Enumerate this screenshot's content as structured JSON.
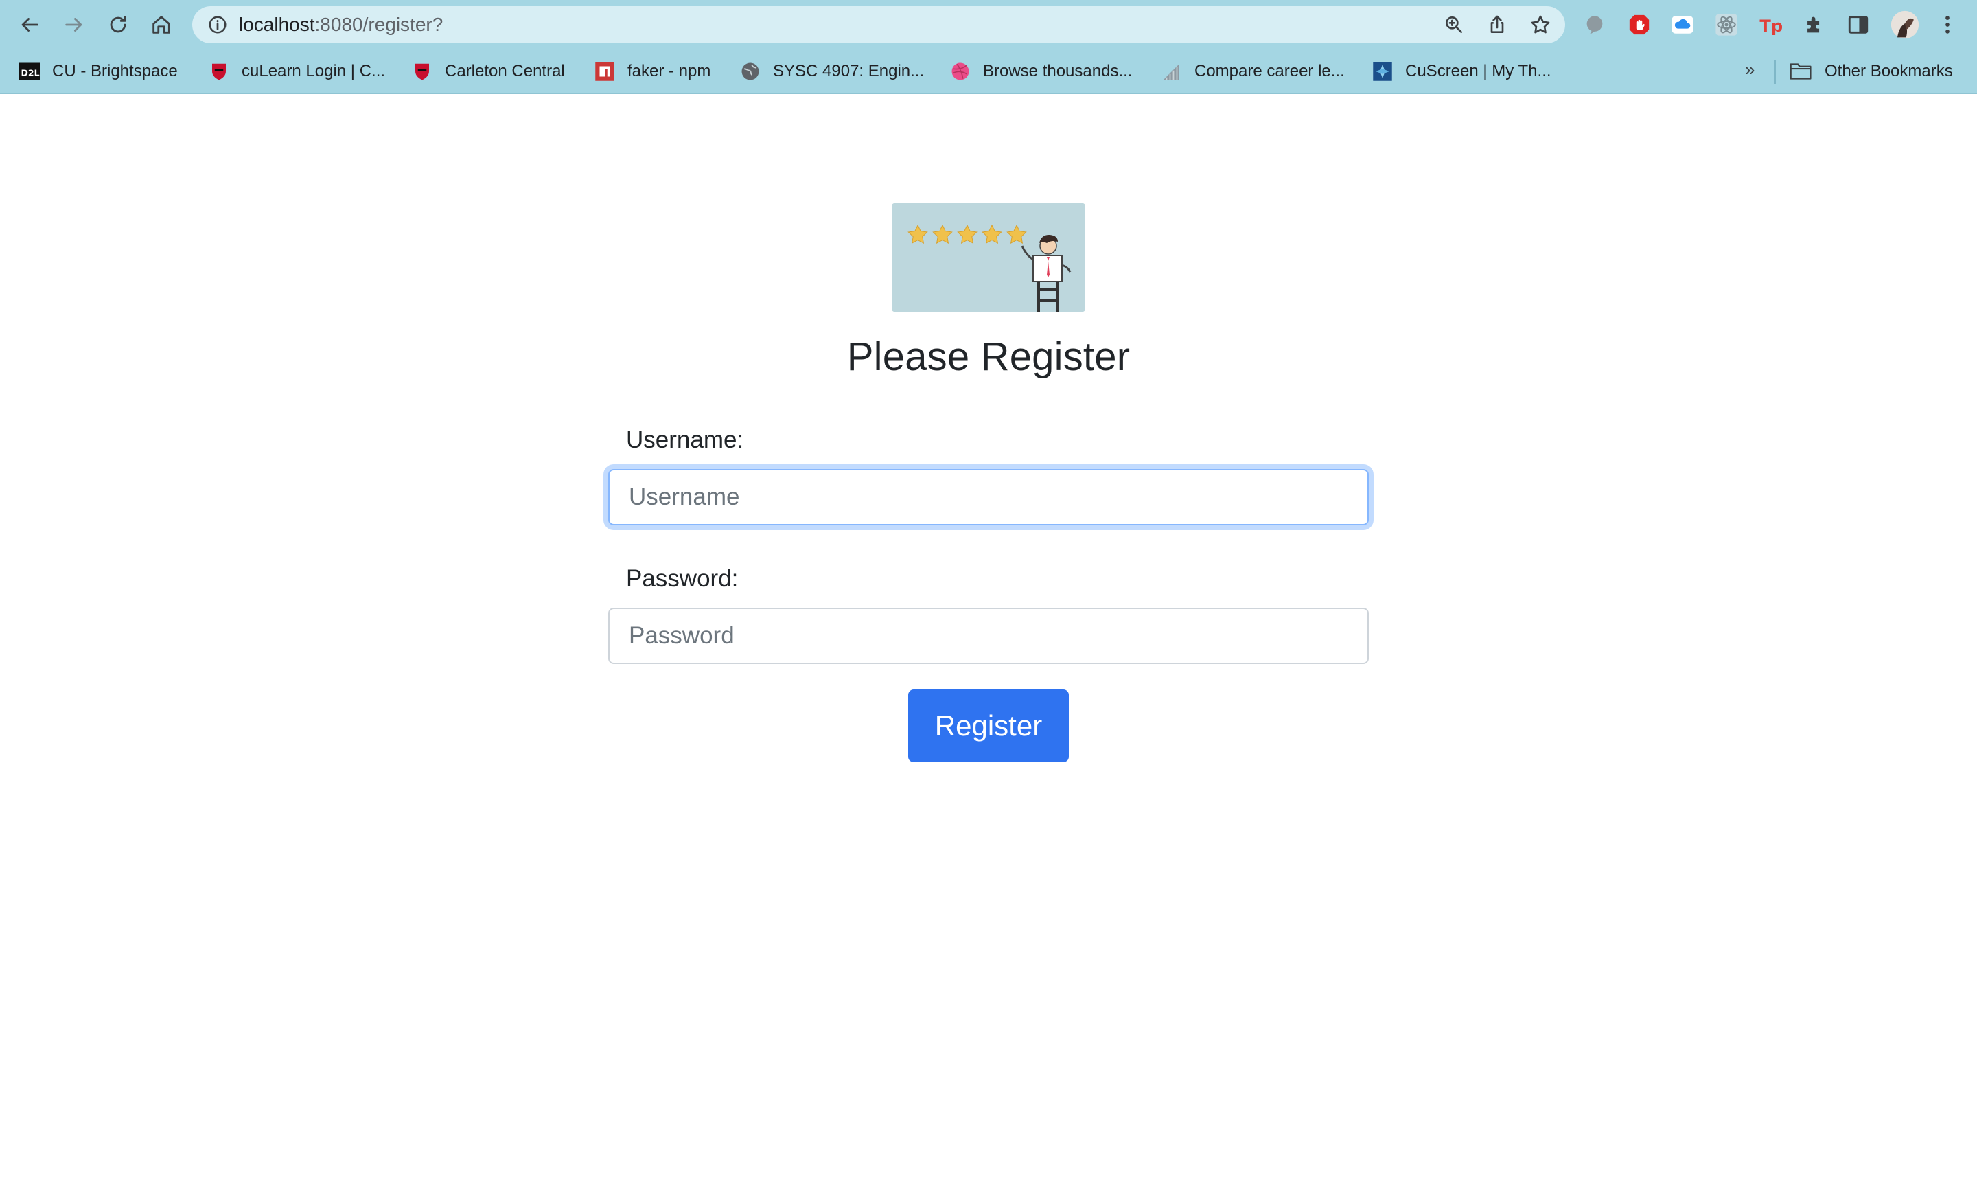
{
  "browser": {
    "url_host": "localhost",
    "url_path": ":8080/register?",
    "bookmarks": [
      {
        "label": "CU - Brightspace",
        "icon": "d2l-icon",
        "color": "#000000"
      },
      {
        "label": "cuLearn Login | C...",
        "icon": "carleton-icon",
        "color": "#c8102e"
      },
      {
        "label": "Carleton Central",
        "icon": "carleton-icon",
        "color": "#c8102e"
      },
      {
        "label": "faker - npm",
        "icon": "npm-icon",
        "color": "#cb3837"
      },
      {
        "label": "SYSC 4907: Engin...",
        "icon": "globe-icon",
        "color": "#5f6368"
      },
      {
        "label": "Browse thousands...",
        "icon": "dribbble-icon",
        "color": "#ea4c89"
      },
      {
        "label": "Compare career le...",
        "icon": "chart-icon",
        "color": "#8e9aa3"
      },
      {
        "label": "CuScreen | My Th...",
        "icon": "cuscreen-icon",
        "color": "#1b4f8a"
      }
    ],
    "other_bookmarks": "Other Bookmarks",
    "more": "»"
  },
  "form": {
    "title": "Please Register",
    "username_label": "Username:",
    "username_placeholder": "Username",
    "password_label": "Password:",
    "password_placeholder": "Password",
    "submit_label": "Register",
    "accent": "#2f73f0"
  }
}
